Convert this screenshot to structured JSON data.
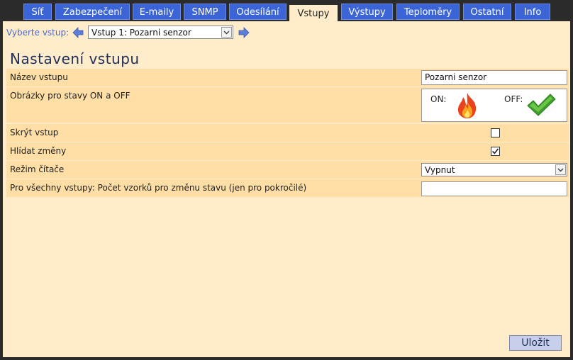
{
  "tabs": [
    {
      "label": "Síť"
    },
    {
      "label": "Zabezpečení"
    },
    {
      "label": "E-maily"
    },
    {
      "label": "SNMP"
    },
    {
      "label": "Odesílání"
    },
    {
      "label": "Vstupy",
      "active": true
    },
    {
      "label": "Výstupy"
    },
    {
      "label": "Teploměry"
    },
    {
      "label": "Ostatní"
    },
    {
      "label": "Info"
    }
  ],
  "selector": {
    "label": "Vyberte vstup:",
    "selected": "Vstup 1: Pozarni senzor"
  },
  "section_title": "Nastavení vstupu",
  "form": {
    "name_label": "Název vstupu",
    "name_value": "Pozarni senzor",
    "images_label": "Obrázky pro stavy ON a OFF",
    "on_label": "ON:",
    "off_label": "OFF:",
    "hide_label": "Skrýt vstup",
    "hide_checked": false,
    "watch_label": "Hlídat změny",
    "watch_checked": true,
    "counter_label": "Režim čítače",
    "counter_value": "Vypnut",
    "samples_label": "Pro všechny vstupy: Počet vzorků pro změnu stavu (jen pro pokročilé)",
    "samples_value": ""
  },
  "save_label": "Uložit",
  "colors": {
    "tab_bg": "#3b64d6",
    "panel_bg": "#ffeccb",
    "row_bg": "#ffdfa6",
    "heading": "#1f2f5a"
  }
}
